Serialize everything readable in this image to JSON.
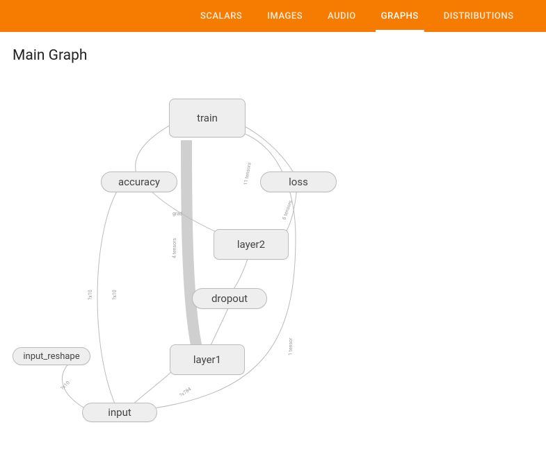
{
  "header": {
    "tabs": [
      {
        "label": "SCALARS",
        "active": false
      },
      {
        "label": "IMAGES",
        "active": false
      },
      {
        "label": "AUDIO",
        "active": false
      },
      {
        "label": "GRAPHS",
        "active": true
      },
      {
        "label": "DISTRIBUTIONS",
        "active": false
      }
    ]
  },
  "title": "Main Graph",
  "graph": {
    "nodes": {
      "train": "train",
      "accuracy": "accuracy",
      "loss": "loss",
      "layer2": "layer2",
      "dropout": "dropout",
      "layer1": "layer1",
      "input_reshape": "input_reshape",
      "input": "input"
    },
    "edge_labels": {
      "grad": "grad",
      "tensors11": "11 tensors",
      "tensors6": "6 tensors",
      "tensors4": "4 tensors",
      "tensor1": "1 tensor",
      "x784": "?x784",
      "x10": "?x10"
    }
  }
}
